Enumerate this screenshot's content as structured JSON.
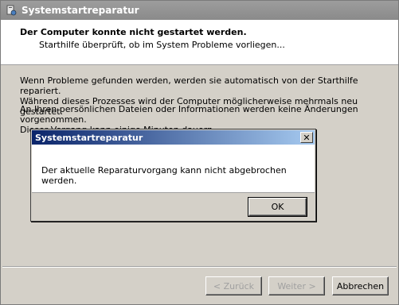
{
  "window": {
    "title": "Systemstartreparatur"
  },
  "header": {
    "title": "Der Computer konnte nicht gestartet werden.",
    "subtitle": "Starthilfe überprüft, ob im System Probleme vorliegen..."
  },
  "body": {
    "paragraph1_line1": "Wenn Probleme gefunden werden, werden sie automatisch von der Starthilfe repariert.",
    "paragraph1_line2": "Während dieses Prozesses wird der Computer möglicherweise mehrmals neu gestartet.",
    "paragraph2_line1": "An Ihren persönlichen Dateien oder Informationen werden keine Änderungen vorgenommen.",
    "paragraph2_line2": "Dieser Vorgang kann einige Minuten dauern."
  },
  "buttons": {
    "back": "< Zurück",
    "next": "Weiter >",
    "cancel": "Abbrechen"
  },
  "dialog": {
    "title": "Systemstartreparatur",
    "close": "✕",
    "message": "Der aktuelle Reparaturvorgang kann nicht abgebrochen werden.",
    "ok": "OK"
  }
}
